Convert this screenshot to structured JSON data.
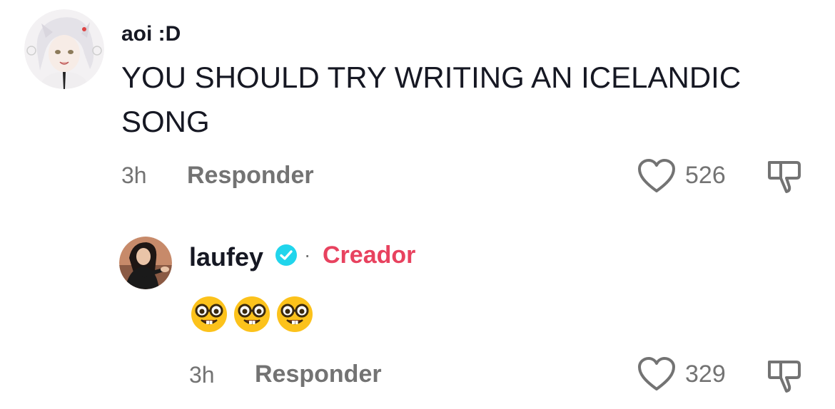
{
  "comment": {
    "username": "aoi :D",
    "text": "YOU SHOULD TRY WRITING AN ICELANDIC SONG",
    "time": "3h",
    "reply_label": "Responder",
    "likes": "526",
    "avatar_icon": "anime-avatar-icon"
  },
  "reply": {
    "username": "laufey",
    "verified_icon": "verified-badge-icon",
    "separator": "·",
    "creator_label": "Creador",
    "emojis": [
      "nerd-face",
      "nerd-face",
      "nerd-face"
    ],
    "time": "3h",
    "reply_label": "Responder",
    "likes": "329",
    "avatar_icon": "profile-photo-avatar-icon"
  },
  "colors": {
    "text_primary": "#161823",
    "text_secondary": "#737373",
    "creator_accent": "#e8425f",
    "verified_blue": "#20d5ec"
  }
}
